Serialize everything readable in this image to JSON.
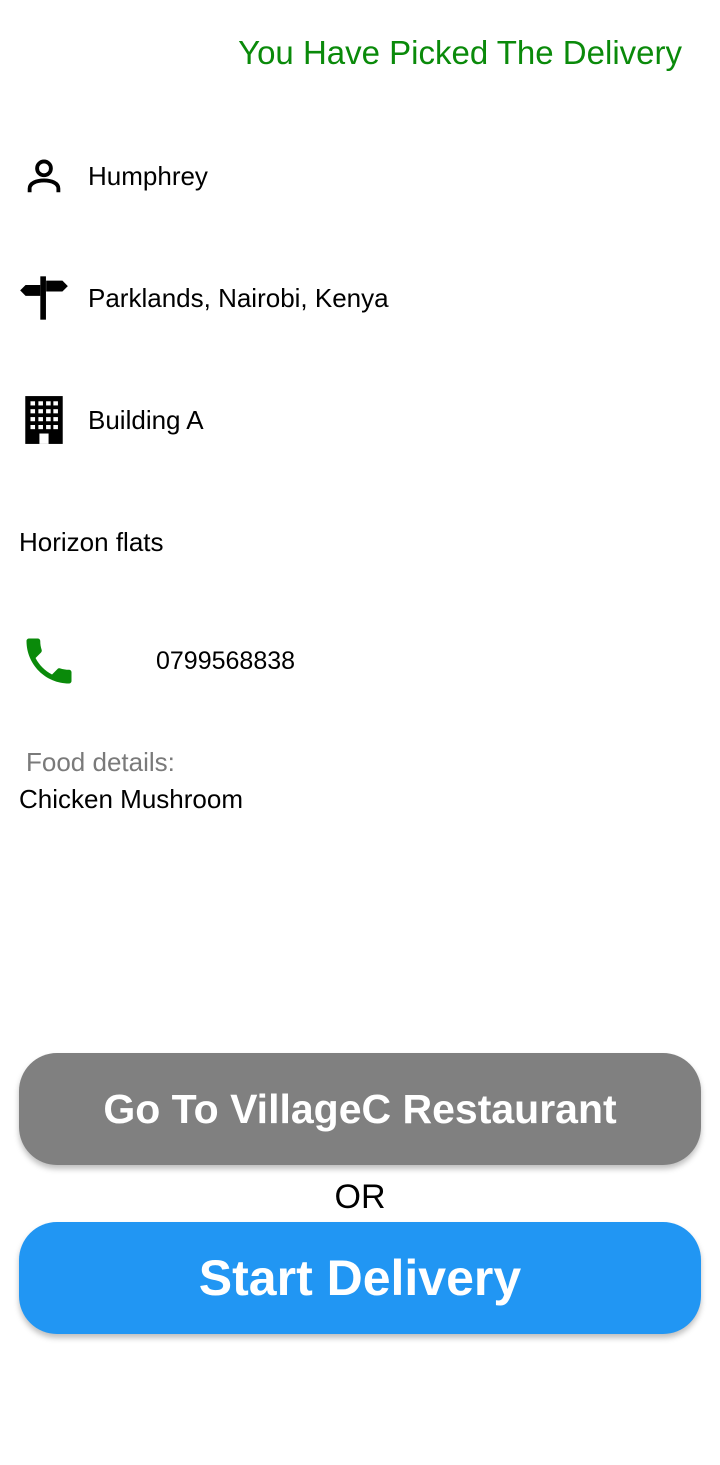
{
  "header": {
    "status_title": "You Have Picked The Delivery",
    "status_color": "#0a8a0a"
  },
  "customer": {
    "name": "Humphrey",
    "location": "Parklands, Nairobi, Kenya",
    "building": "Building A",
    "flats": "Horizon flats",
    "phone": "0799568838"
  },
  "food": {
    "label": "Food details:",
    "value": "Chicken Mushroom"
  },
  "actions": {
    "restaurant_button_label": "Go To VillageC Restaurant",
    "or_label": "OR",
    "start_button_label": "Start Delivery"
  },
  "icons": {
    "person": "person-icon",
    "signpost": "signpost-icon",
    "building": "building-icon",
    "phone": "phone-icon"
  },
  "colors": {
    "phone_icon": "#0a8a0a",
    "restaurant_button": "#808080",
    "start_button": "#2196f3"
  }
}
